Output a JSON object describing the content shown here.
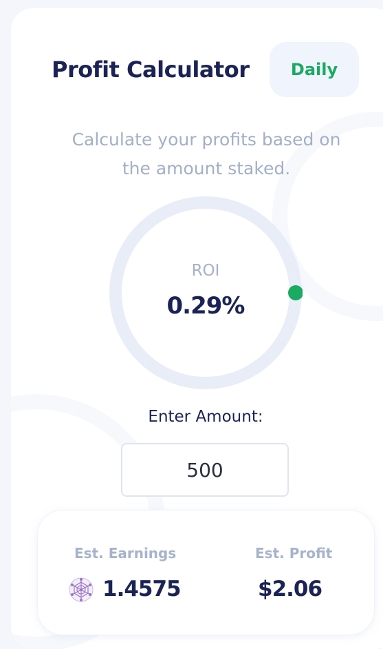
{
  "header": {
    "title": "Profit Calculator",
    "period_label": "Daily"
  },
  "description": "Calculate your profits based on the amount staked.",
  "roi": {
    "label": "ROI",
    "value": "0.29%",
    "gauge_fraction": 0.25
  },
  "amount": {
    "label": "Enter Amount:",
    "value": "500"
  },
  "results": {
    "earnings_label": "Est. Earnings",
    "earnings_value": "1.4575",
    "earnings_icon": "token-network-icon",
    "profit_label": "Est. Profit",
    "profit_value": "$2.06"
  },
  "colors": {
    "accent_green": "#1aaa62",
    "primary_text": "#1b2356",
    "muted_text": "#a3afc8",
    "token_purple": "#9b74c6"
  }
}
